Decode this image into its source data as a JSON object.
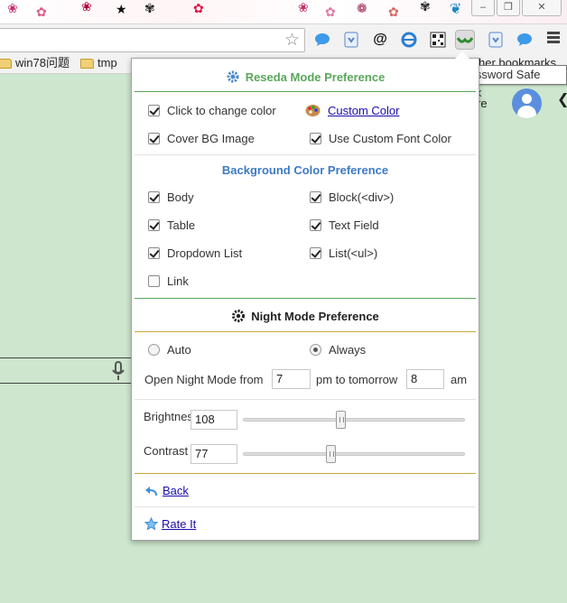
{
  "window": {
    "minimize_glyph": "–",
    "restore_glyph": "❐",
    "close_glyph": "✕"
  },
  "bookmarks_bar": {
    "items": [
      {
        "label": "win78问题",
        "icon": "folder-icon"
      },
      {
        "label": "tmp",
        "icon": "folder-icon"
      }
    ],
    "other_bookmarks": "her bookmarks"
  },
  "tooltip": "Password Safe Box",
  "page": {
    "partial_text": "re"
  },
  "colors": {
    "accent_green": "#5aa75a",
    "heading_blue": "#3d7ac3",
    "night_border": "#c9a83a",
    "page_bg": "#cde6cd",
    "link": "#1a0dab"
  },
  "popup": {
    "title": "Reseda Mode Preference",
    "general": {
      "click_to_change": {
        "label": "Click to change color",
        "checked": true
      },
      "custom_color_link": "Custom Color",
      "cover_bg_image": {
        "label": "Cover BG Image",
        "checked": true
      },
      "use_custom_font": {
        "label": "Use Custom Font Color",
        "checked": true
      }
    },
    "bg_pref": {
      "heading": "Background Color Preference",
      "items": {
        "body": {
          "label": "Body",
          "checked": true
        },
        "block": {
          "label": "Block(<div>)",
          "checked": true
        },
        "table": {
          "label": "Table",
          "checked": true
        },
        "text_field": {
          "label": "Text Field",
          "checked": true
        },
        "dropdown": {
          "label": "Dropdown List",
          "checked": true
        },
        "list": {
          "label": "List(<ul>)",
          "checked": true
        },
        "link": {
          "label": "Link",
          "checked": false
        }
      }
    },
    "night": {
      "heading": "Night Mode Preference",
      "auto": {
        "label": "Auto",
        "selected": false
      },
      "always": {
        "label": "Always",
        "selected": true
      },
      "from_label": "Open Night Mode from",
      "from_value": "7",
      "pm_label": "pm to tomorrow",
      "to_value": "8",
      "am_label": "am",
      "brightness_label": "Brightness",
      "brightness_value": "108",
      "brightness_level": 0.44,
      "contrast_label": "Contrast",
      "contrast_value": "77",
      "contrast_level": 0.39
    },
    "back_link": "Back",
    "rate_link": "Rate It"
  }
}
